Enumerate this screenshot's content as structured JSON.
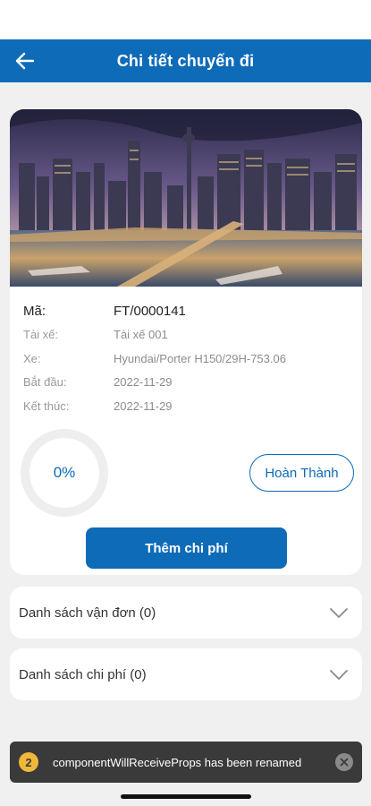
{
  "header": {
    "title": "Chi tiết chuyến đi"
  },
  "trip": {
    "rows": [
      {
        "label": "Mã:",
        "value": "FT/0000141"
      },
      {
        "label": "Tài xế:",
        "value": "Tài xế 001"
      },
      {
        "label": "Xe:",
        "value": "Hyundai/Porter H150/29H-753.06"
      },
      {
        "label": "Bắt đầu:",
        "value": "2022-11-29"
      },
      {
        "label": "Kết thúc:",
        "value": "2022-11-29"
      }
    ],
    "progress_text": "0%",
    "progress_value": 0
  },
  "actions": {
    "done_label": "Hoàn Thành",
    "add_cost_label": "Thêm chi phí"
  },
  "sections": {
    "orders_label": "Danh sách vận đơn (0)",
    "costs_label": "Danh sách chi phí (0)"
  },
  "toast": {
    "count": "2",
    "message": "componentWillReceiveProps has been renamed"
  },
  "colors": {
    "primary": "#0d6bb8",
    "background": "#f0f0f0",
    "toast": "#3a3a3a",
    "badge": "#f0b83a"
  }
}
